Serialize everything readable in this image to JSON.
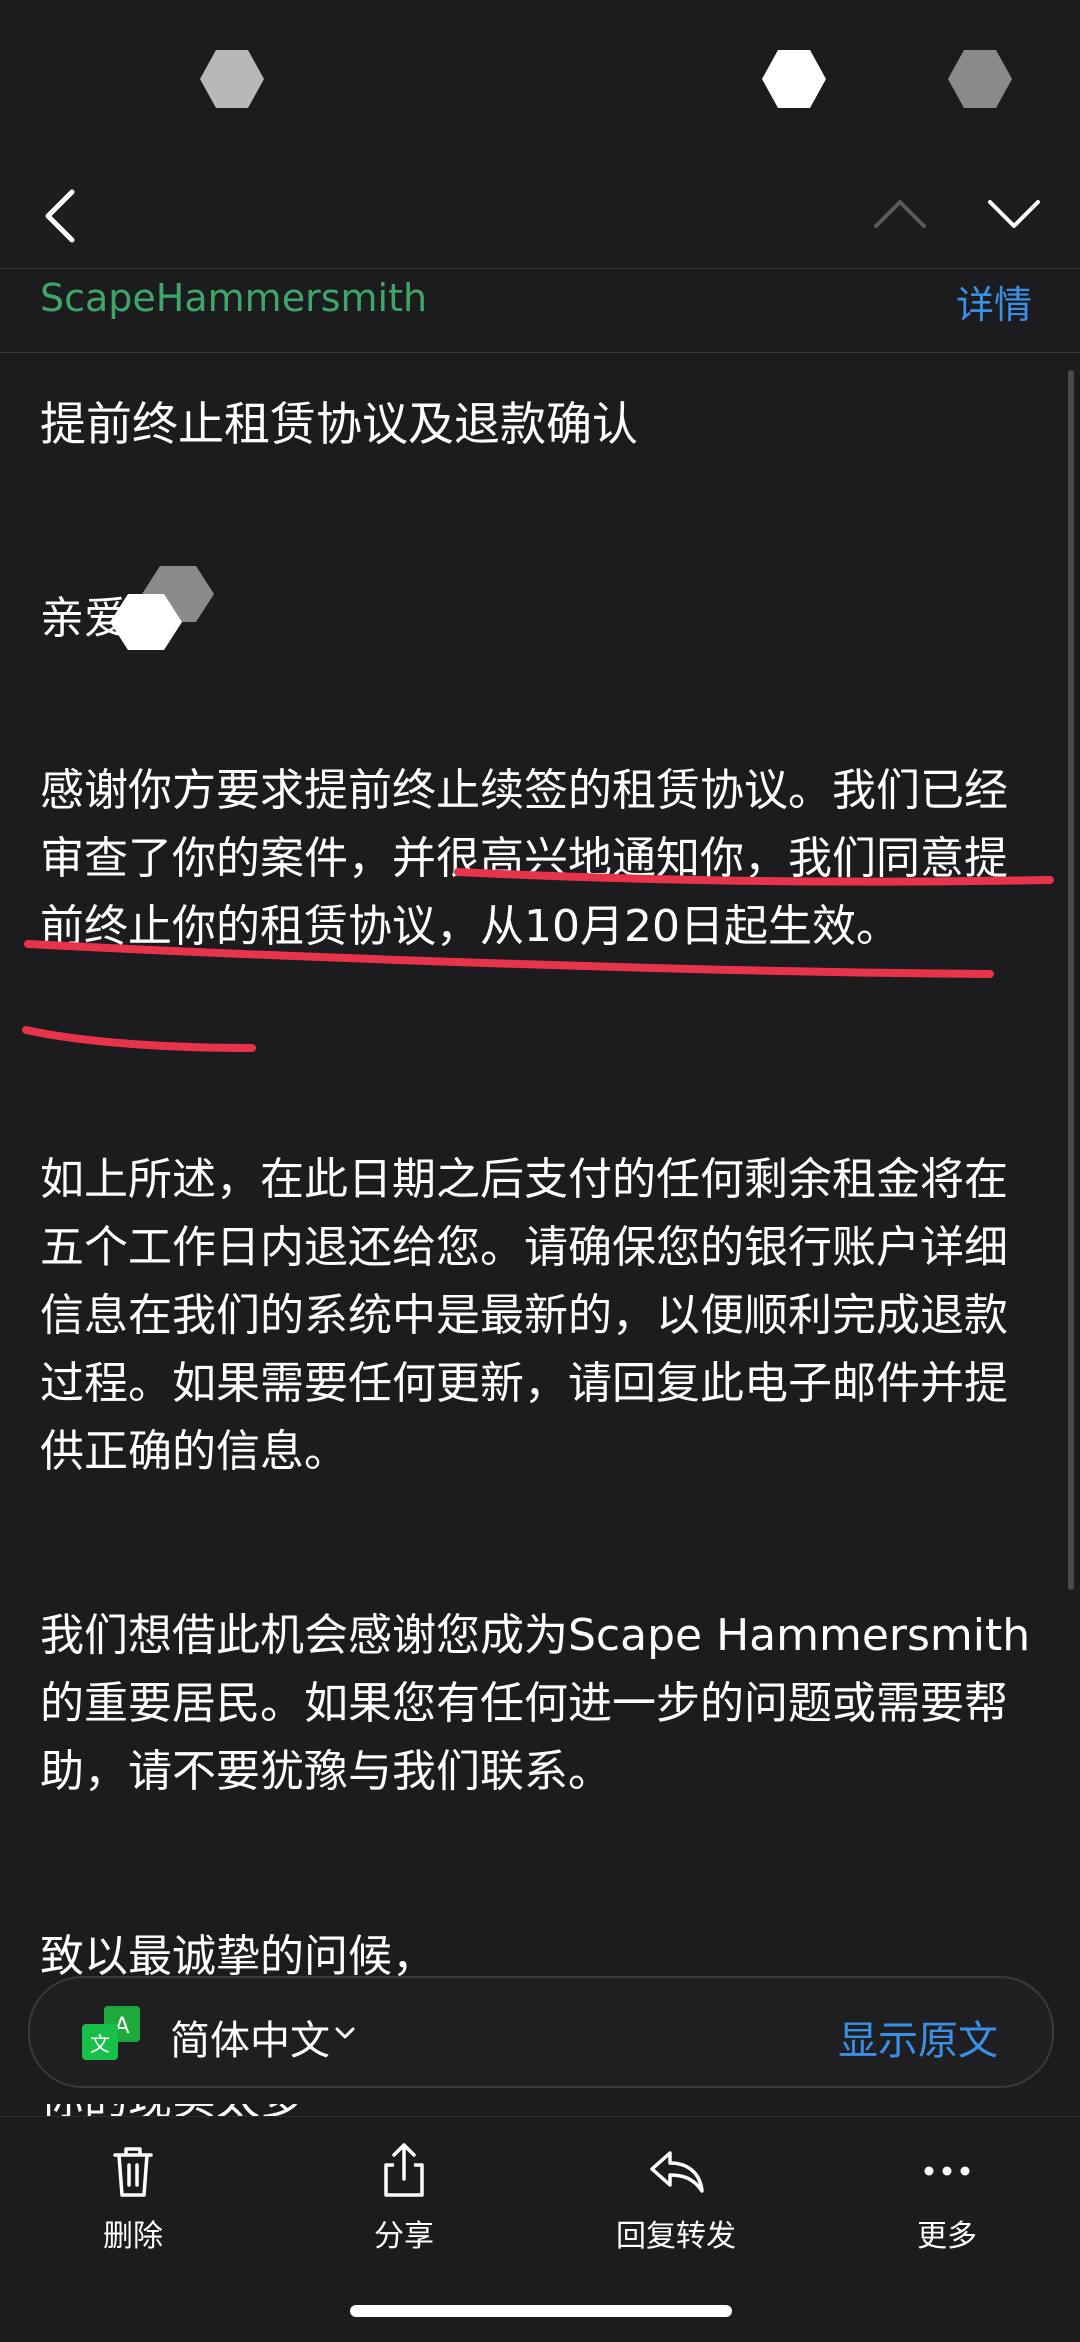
{
  "header": {
    "sender": "ScapeHammersmith",
    "details_label": "详情"
  },
  "email": {
    "subject": "提前终止租赁协议及退款确认",
    "greeting": "亲爱",
    "paragraph1": "感谢你方要求提前终止续签的租赁协议。我们已经审查了你的案件，并很高兴地通知你，我们同意提前终止你的租赁协议，从10月20日起生效。",
    "paragraph2": "如上所述，在此日期之后支付的任何剩余租金将在五个工作日内退还给您。请确保您的银行账户详细信息在我们的系统中是最新的，以便顺利完成退款过程。如果需要任何更新，请回复此电子邮件并提供正确的信息。",
    "paragraph3": "我们想借此机会感谢您成为Scape Hammersmith的重要居民。如果您有任何进一步的问题或需要帮助，请不要犹豫与我们联系。",
    "closing": "致以最诚挚的问候，",
    "next_line_partial": "你的现实太多"
  },
  "translate_bar": {
    "language": "简体中文",
    "show_original": "显示原文"
  },
  "toolbar": {
    "delete": "删除",
    "share": "分享",
    "reply_forward": "回复转发",
    "more": "更多"
  },
  "colors": {
    "background": "#1c1c1e",
    "sender_green": "#3fa66a",
    "link_blue": "#3a8fe6",
    "annotation_red": "#e8344a"
  }
}
